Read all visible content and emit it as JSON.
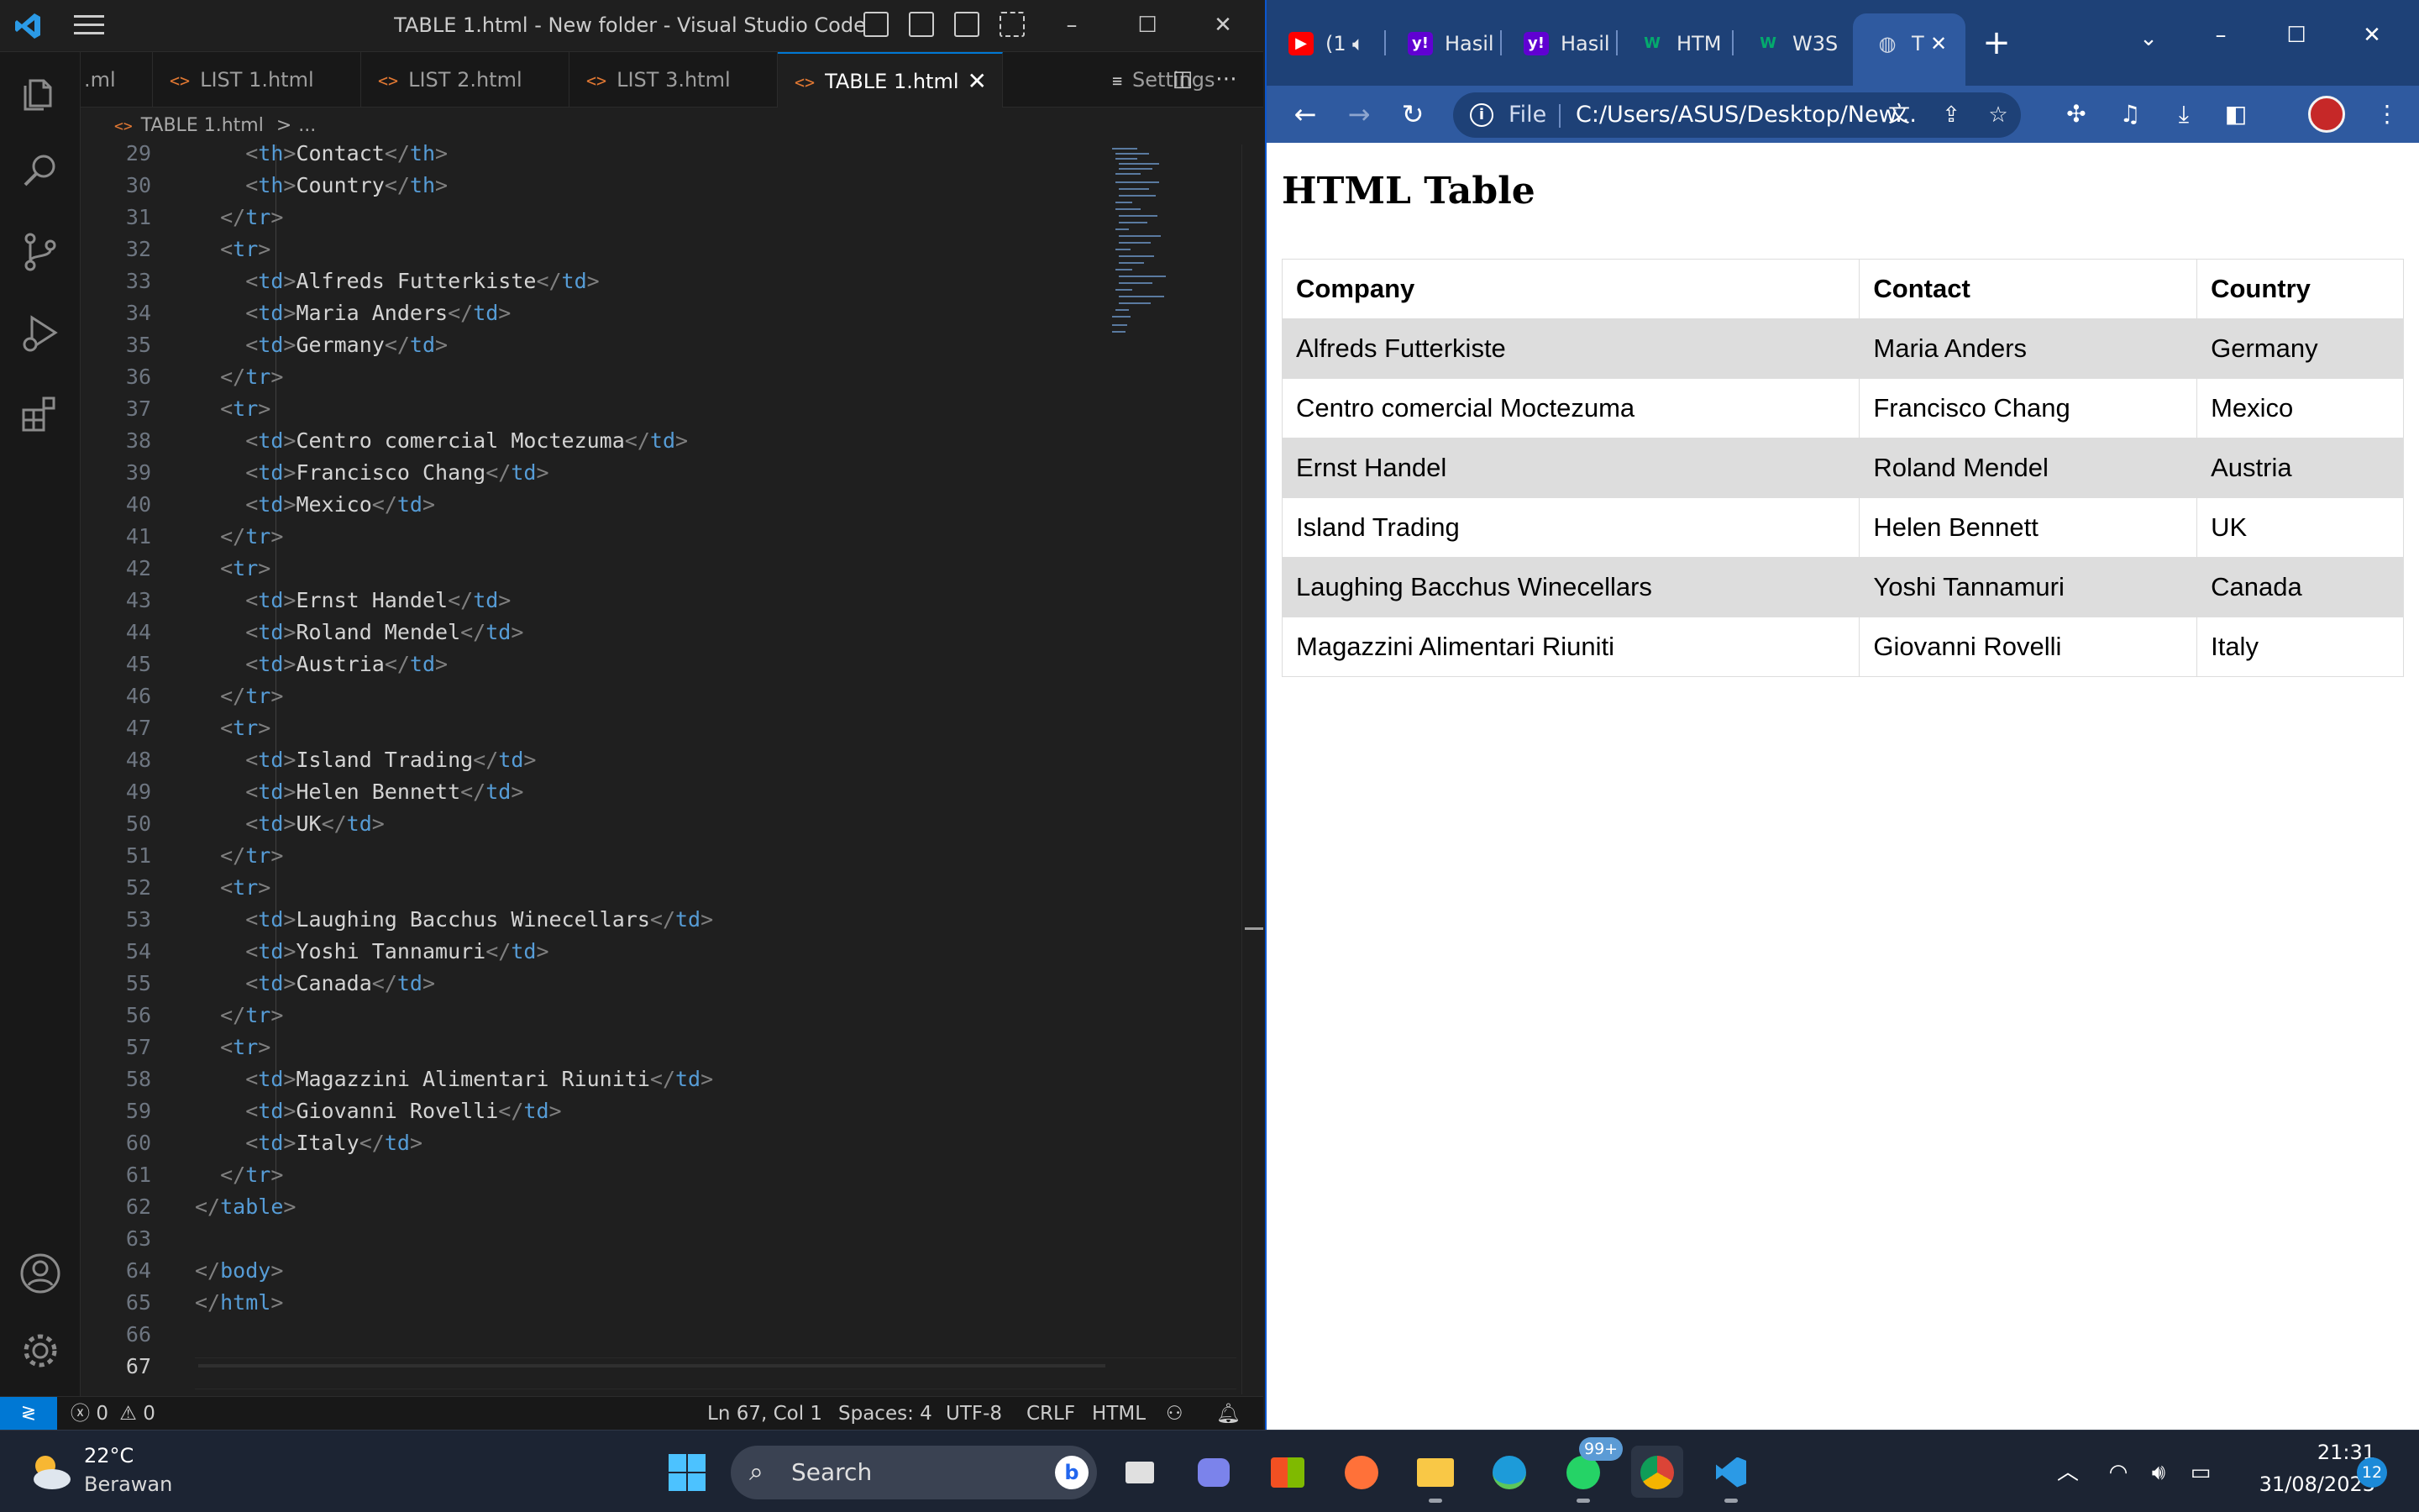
{
  "vscode": {
    "window_title": "TABLE 1.html - New folder - Visual Studio Code",
    "tabs": [
      {
        "label": ".ml",
        "icon": ""
      },
      {
        "label": "LIST 1.html",
        "icon": "<>"
      },
      {
        "label": "LIST 2.html",
        "icon": "<>"
      },
      {
        "label": "LIST 3.html",
        "icon": "<>"
      },
      {
        "label": "TABLE 1.html",
        "icon": "<>"
      },
      {
        "label": "Settings",
        "icon": "≡"
      }
    ],
    "active_tab_close": "✕",
    "breadcrumb": {
      "file": "TABLE 1.html",
      "sep": ">",
      "rest": "..."
    },
    "lines": [
      {
        "n": "29",
        "ind": "    ",
        "open": "th",
        "text": "Contact",
        "close": "th"
      },
      {
        "n": "30",
        "ind": "    ",
        "open": "th",
        "text": "Country",
        "close": "th"
      },
      {
        "n": "31",
        "ind": "  ",
        "close_only": "tr"
      },
      {
        "n": "32",
        "ind": "  ",
        "open_only": "tr"
      },
      {
        "n": "33",
        "ind": "    ",
        "open": "td",
        "text": "Alfreds Futterkiste",
        "close": "td"
      },
      {
        "n": "34",
        "ind": "    ",
        "open": "td",
        "text": "Maria Anders",
        "close": "td"
      },
      {
        "n": "35",
        "ind": "    ",
        "open": "td",
        "text": "Germany",
        "close": "td"
      },
      {
        "n": "36",
        "ind": "  ",
        "close_only": "tr"
      },
      {
        "n": "37",
        "ind": "  ",
        "open_only": "tr"
      },
      {
        "n": "38",
        "ind": "    ",
        "open": "td",
        "text": "Centro comercial Moctezuma",
        "close": "td"
      },
      {
        "n": "39",
        "ind": "    ",
        "open": "td",
        "text": "Francisco Chang",
        "close": "td"
      },
      {
        "n": "40",
        "ind": "    ",
        "open": "td",
        "text": "Mexico",
        "close": "td"
      },
      {
        "n": "41",
        "ind": "  ",
        "close_only": "tr"
      },
      {
        "n": "42",
        "ind": "  ",
        "open_only": "tr"
      },
      {
        "n": "43",
        "ind": "    ",
        "open": "td",
        "text": "Ernst Handel",
        "close": "td"
      },
      {
        "n": "44",
        "ind": "    ",
        "open": "td",
        "text": "Roland Mendel",
        "close": "td"
      },
      {
        "n": "45",
        "ind": "    ",
        "open": "td",
        "text": "Austria",
        "close": "td"
      },
      {
        "n": "46",
        "ind": "  ",
        "close_only": "tr"
      },
      {
        "n": "47",
        "ind": "  ",
        "open_only": "tr"
      },
      {
        "n": "48",
        "ind": "    ",
        "open": "td",
        "text": "Island Trading",
        "close": "td"
      },
      {
        "n": "49",
        "ind": "    ",
        "open": "td",
        "text": "Helen Bennett",
        "close": "td"
      },
      {
        "n": "50",
        "ind": "    ",
        "open": "td",
        "text": "UK",
        "close": "td"
      },
      {
        "n": "51",
        "ind": "  ",
        "close_only": "tr"
      },
      {
        "n": "52",
        "ind": "  ",
        "open_only": "tr"
      },
      {
        "n": "53",
        "ind": "    ",
        "open": "td",
        "text": "Laughing Bacchus Winecellars",
        "close": "td"
      },
      {
        "n": "54",
        "ind": "    ",
        "open": "td",
        "text": "Yoshi Tannamuri",
        "close": "td"
      },
      {
        "n": "55",
        "ind": "    ",
        "open": "td",
        "text": "Canada",
        "close": "td"
      },
      {
        "n": "56",
        "ind": "  ",
        "close_only": "tr"
      },
      {
        "n": "57",
        "ind": "  ",
        "open_only": "tr"
      },
      {
        "n": "58",
        "ind": "    ",
        "open": "td",
        "text": "Magazzini Alimentari Riuniti",
        "close": "td"
      },
      {
        "n": "59",
        "ind": "    ",
        "open": "td",
        "text": "Giovanni Rovelli",
        "close": "td"
      },
      {
        "n": "60",
        "ind": "    ",
        "open": "td",
        "text": "Italy",
        "close": "td"
      },
      {
        "n": "61",
        "ind": "  ",
        "close_only": "tr"
      },
      {
        "n": "62",
        "ind": "",
        "close_only": "table"
      },
      {
        "n": "63",
        "ind": ""
      },
      {
        "n": "64",
        "ind": "",
        "close_only": "body"
      },
      {
        "n": "65",
        "ind": "",
        "close_only": "html"
      },
      {
        "n": "66",
        "ind": ""
      },
      {
        "n": "67",
        "ind": "",
        "current": true
      }
    ],
    "status": {
      "errors": "0",
      "warnings": "0",
      "position": "Ln 67, Col 1",
      "spaces": "Spaces: 4",
      "encoding": "UTF-8",
      "eol": "CRLF",
      "language": "HTML"
    }
  },
  "chrome": {
    "tabs": [
      {
        "label": "(1",
        "favicon": "youtube-icon",
        "color": "#ff0000"
      },
      {
        "label": "Hasil",
        "favicon": "yahoo-icon",
        "color": "#6001d2"
      },
      {
        "label": "Hasil",
        "favicon": "yahoo-icon",
        "color": "#6001d2"
      },
      {
        "label": "HTM",
        "favicon": "w3schools-icon",
        "color": "#04aa6d"
      },
      {
        "label": "W3S",
        "favicon": "w3schools-icon",
        "color": "#04aa6d"
      },
      {
        "label": "T",
        "favicon": "globe-icon",
        "color": "#9aa0a6"
      }
    ],
    "omnibox": {
      "scheme_label": "File",
      "url": "C:/Users/ASUS/Desktop/New..."
    },
    "page": {
      "heading": "HTML Table",
      "table": {
        "headers": [
          "Company",
          "Contact",
          "Country"
        ],
        "rows": [
          [
            "Alfreds Futterkiste",
            "Maria Anders",
            "Germany"
          ],
          [
            "Centro comercial Moctezuma",
            "Francisco Chang",
            "Mexico"
          ],
          [
            "Ernst Handel",
            "Roland Mendel",
            "Austria"
          ],
          [
            "Island Trading",
            "Helen Bennett",
            "UK"
          ],
          [
            "Laughing Bacchus Winecellars",
            "Yoshi Tannamuri",
            "Canada"
          ],
          [
            "Magazzini Alimentari Riuniti",
            "Giovanni Rovelli",
            "Italy"
          ]
        ],
        "shade_color": "#dddddd"
      }
    }
  },
  "taskbar": {
    "weather": {
      "temp": "22°C",
      "condition": "Berawan"
    },
    "search_placeholder": "Search",
    "whatsapp_badge": "99+",
    "clock": {
      "time": "21:31",
      "date": "31/08/2023"
    },
    "notifications": "12"
  },
  "colors": {
    "vscode_accent": "#0078d4",
    "tag_blue": "#569cd6",
    "chrome_frame": "#1e4177",
    "chrome_toolbar": "#2f5aa0"
  }
}
